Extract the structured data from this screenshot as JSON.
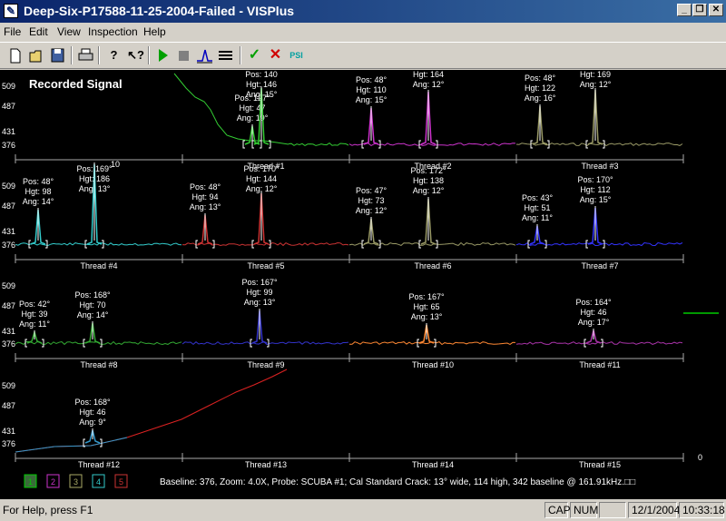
{
  "window": {
    "title": "Deep-Six-P17588-11-25-2004-Failed - VISPlus",
    "minimize_label": "_",
    "maximize_label": "❐",
    "close_label": "✕"
  },
  "menu": {
    "file": "File",
    "edit": "Edit",
    "view": "View",
    "inspection": "Inspection",
    "help": "Help"
  },
  "toolbar": {
    "new_icon": "new-file-icon",
    "open_icon": "open-folder-icon",
    "save_icon": "save-icon",
    "print_icon": "print-icon",
    "help_icon": "help-icon",
    "context_help_icon": "context-help-icon",
    "play_icon": "play-icon",
    "stop_icon": "stop-icon",
    "peak_icon": "peak-icon",
    "list_icon": "list-icon",
    "accept_icon": "checkmark-icon",
    "reject_icon": "reject-icon",
    "psi_label": "PSI"
  },
  "signal": {
    "title": "Recorded Signal",
    "y_ticks": [
      "509",
      "487",
      "431",
      "376"
    ],
    "row_ticks": [
      [
        "509",
        "487",
        "431",
        "376"
      ],
      [
        "509",
        "487",
        "431",
        "376"
      ],
      [
        "509",
        "487",
        "431",
        "376"
      ],
      [
        "509",
        "487",
        "431",
        "376"
      ]
    ],
    "threads": [
      "Thread #1",
      "Thread #2",
      "Thread #3",
      "Thread #4",
      "Thread #5",
      "Thread #6",
      "Thread #7",
      "Thread #8",
      "Thread #9",
      "Thread #10",
      "Thread #11",
      "Thread #12",
      "Thread #13",
      "Thread #14",
      "Thread #15"
    ],
    "peaks": [
      {
        "pos": "Pos: 127°",
        "hgt": "Hgt: 47",
        "ang": "Ang: 19°"
      },
      {
        "pos": "Pos: 140",
        "hgt": "Hgt: 146",
        "ang": "Ang: 15°"
      },
      {
        "pos": "Pos: 48°",
        "hgt": "Hgt: 110",
        "ang": "Ang: 15°"
      },
      {
        "pos": "Hgt: 164",
        "hgt": "Ang: 12°",
        "ang": ""
      },
      {
        "pos": "Pos: 48°",
        "hgt": "Hgt: 122",
        "ang": "Ang: 16°"
      },
      {
        "pos": "Hgt: 169",
        "hgt": "Ang: 12°",
        "ang": ""
      },
      {
        "pos": "Pos: 48°",
        "hgt": "Hgt: 98",
        "ang": "Ang: 14°"
      },
      {
        "pos": "Pos: 169°",
        "hgt": "Hgt: 186",
        "ang": "Ang: 13°"
      },
      {
        "pos": "Pos: 48°",
        "hgt": "Hgt: 94",
        "ang": "Ang: 13°"
      },
      {
        "pos": "Pos: 170°",
        "hgt": "Hgt: 144",
        "ang": "Ang: 12°"
      },
      {
        "pos": "Pos: 47°",
        "hgt": "Hgt: 73",
        "ang": "Ang: 12°"
      },
      {
        "pos": "Pos: 172°",
        "hgt": "Hgt: 138",
        "ang": "Ang: 12°"
      },
      {
        "pos": "Pos: 43°",
        "hgt": "Hgt: 51",
        "ang": "Ang: 11°"
      },
      {
        "pos": "Pos: 170°",
        "hgt": "Hgt: 112",
        "ang": "Ang: 15°"
      },
      {
        "pos": "Pos: 42°",
        "hgt": "Hgt: 39",
        "ang": "Ang: 11°"
      },
      {
        "pos": "Pos: 168°",
        "hgt": "Hgt: 70",
        "ang": "Ang: 14°"
      },
      {
        "pos": "Pos: 167°",
        "hgt": "Hgt: 99",
        "ang": "Ang: 13°"
      },
      {
        "pos": "Pos: 167°",
        "hgt": "Hgt: 65",
        "ang": "Ang: 13°"
      },
      {
        "pos": "Pos: 164°",
        "hgt": "Hgt: 46",
        "ang": "Ang: 17°"
      },
      {
        "pos": "Pos: 168°",
        "hgt": "Hgt: 46",
        "ang": "Ang: 9°"
      }
    ],
    "channel_buttons": [
      "1",
      "2",
      "3",
      "4",
      "5"
    ],
    "channel_colors": [
      "#00cc00",
      "#cc33cc",
      "#aaaa66",
      "#33cccc",
      "#cc3333"
    ],
    "info_line": "Baseline: 376, Zoom: 4.0X, Probe: SCUBA #1; Cal Standard Crack: 13° wide, 114 high, 342 baseline @ 161.91kHz.□□",
    "right_value": "0",
    "stray_value": "10"
  },
  "status": {
    "help_text": "For Help, press F1",
    "cap": "CAP",
    "num": "NUM",
    "date": "12/1/2004",
    "time": "10:33:18"
  }
}
